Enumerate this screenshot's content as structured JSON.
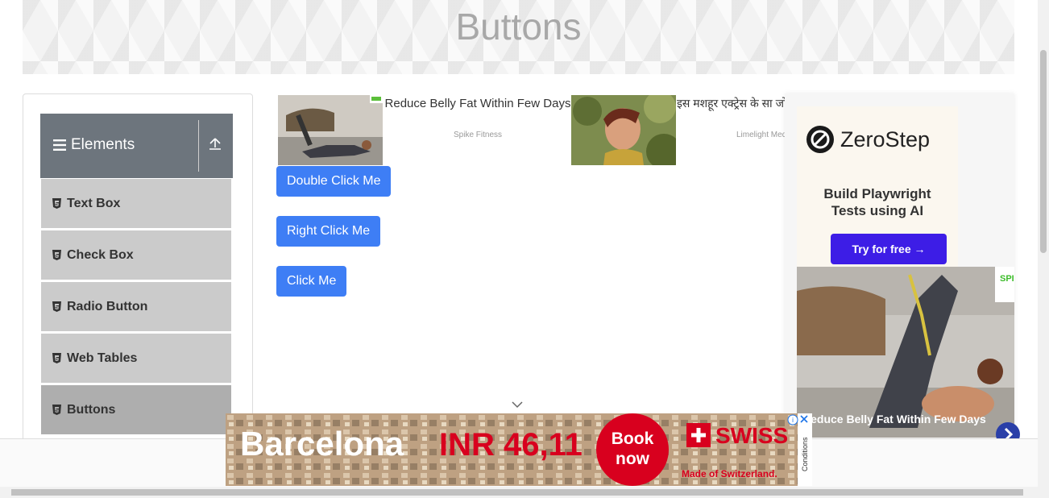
{
  "header": {
    "title": "Buttons"
  },
  "sidebar": {
    "group_title": "Elements",
    "items": [
      {
        "label": "Text Box"
      },
      {
        "label": "Check Box"
      },
      {
        "label": "Radio Button"
      },
      {
        "label": "Web Tables"
      },
      {
        "label": "Buttons",
        "active": true
      }
    ]
  },
  "buttons": {
    "double_click": "Double Click Me",
    "right_click": "Right Click Me",
    "click": "Click Me"
  },
  "ads": {
    "native": [
      {
        "headline": "Reduce Belly Fat Within Few Days",
        "source": "Spike Fitness"
      },
      {
        "headline": "इस मशहूर एक्ट्रेस के सा जो हुआ वो बेहद द",
        "source": "Limelight Med"
      }
    ],
    "side": {
      "brand": "ZeroStep",
      "tagline": "Build Playwright Tests using AI",
      "cta": "Try for free →",
      "photo_caption": "Reduce Belly Fat Within Few Days",
      "badge": "SPIK"
    },
    "bottom": {
      "city": "Barcelona",
      "price": "INR 46,11",
      "cta": "Book now",
      "brand": "SWISS",
      "slogan": "Made of Switzerland.",
      "conditions": "Conditions"
    }
  },
  "colors": {
    "primary_button": "#3e7ef5",
    "sidebar_header": "#6d757d",
    "cta_purple": "#3d1de6",
    "ad_red": "#d8001e"
  }
}
